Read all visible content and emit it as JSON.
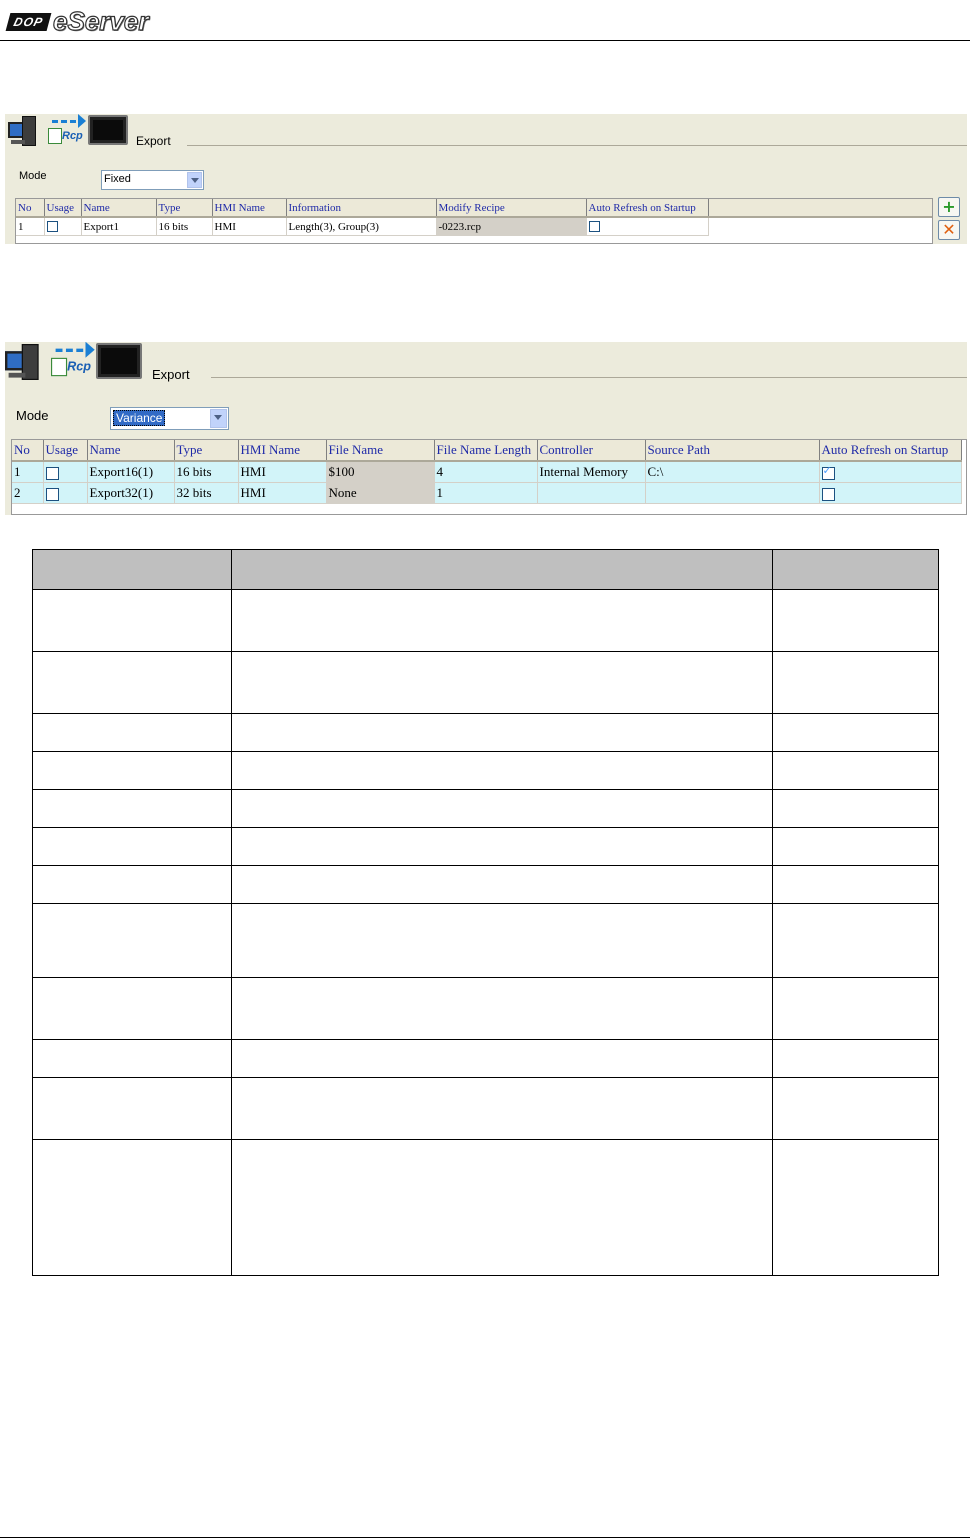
{
  "header": {
    "logo_badge": "DOP",
    "logo_text": "eServer"
  },
  "panel1": {
    "title": "Export",
    "mode_label": "Mode",
    "mode_value": "Fixed",
    "columns": [
      "No",
      "Usage",
      "Name",
      "Type",
      "HMI Name",
      "Information",
      "Modify Recipe",
      "Auto Refresh on Startup"
    ],
    "rows": [
      {
        "no": "1",
        "usage": false,
        "name": "Export1",
        "type": "16 bits",
        "hmi_name": "HMI",
        "information": "Length(3), Group(3)",
        "modify_recipe": "-0223.rcp",
        "auto_refresh": false
      }
    ],
    "add_icon": "plus-icon",
    "delete_icon": "x-icon"
  },
  "panel2": {
    "title": "Export",
    "mode_label": "Mode",
    "mode_value": "Variance",
    "columns": [
      "No",
      "Usage",
      "Name",
      "Type",
      "HMI Name",
      "File Name",
      "File Name Length",
      "Controller",
      "Source Path",
      "Auto Refresh on Startup"
    ],
    "rows": [
      {
        "no": "1",
        "usage": false,
        "name": "Export16(1)",
        "type": "16 bits",
        "hmi_name": "HMI",
        "file_name": "$100",
        "file_name_length": "4",
        "controller": "Internal Memory",
        "source_path": "C:\\",
        "auto_refresh": true
      },
      {
        "no": "2",
        "usage": false,
        "name": "Export32(1)",
        "type": "32 bits",
        "hmi_name": "HMI",
        "file_name": "None",
        "file_name_length": "1",
        "controller": "",
        "source_path": "",
        "auto_refresh": false
      }
    ]
  },
  "doc_table": {
    "row_heights": [
      62,
      62,
      38,
      38,
      38,
      38,
      38,
      74,
      62,
      38,
      62,
      136
    ]
  }
}
